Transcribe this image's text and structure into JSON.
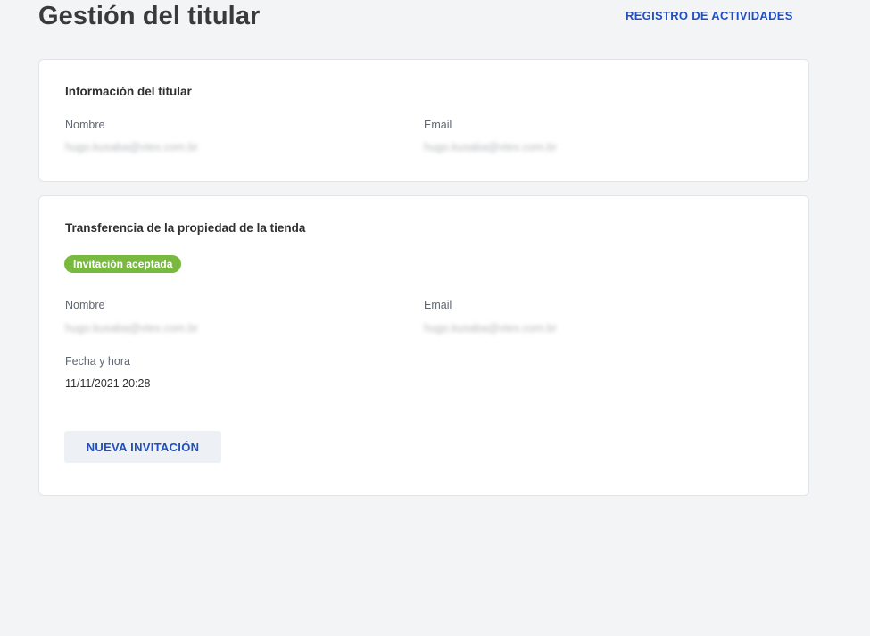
{
  "header": {
    "title": "Gestión del titular",
    "activity_link": "REGISTRO DE ACTIVIDADES"
  },
  "owner_info": {
    "title": "Información del titular",
    "name_label": "Nombre",
    "name_value": "hugo.kusaba@vtex.com.br",
    "email_label": "Email",
    "email_value": "hugo.kusaba@vtex.com.br"
  },
  "transfer": {
    "title": "Transferencia de la propiedad de la tienda",
    "status_badge": "Invitación aceptada",
    "name_label": "Nombre",
    "name_value": "hugo.kusaba@vtex.com.br",
    "email_label": "Email",
    "email_value": "hugo.kusaba@vtex.com.br",
    "datetime_label": "Fecha y hora",
    "datetime_value": "11/11/2021 20:28",
    "new_invite_button": "NUEVA INVITACIÓN"
  },
  "colors": {
    "accent": "#1f4fc1",
    "success_badge": "#79b940",
    "background": "#f3f4f6"
  }
}
